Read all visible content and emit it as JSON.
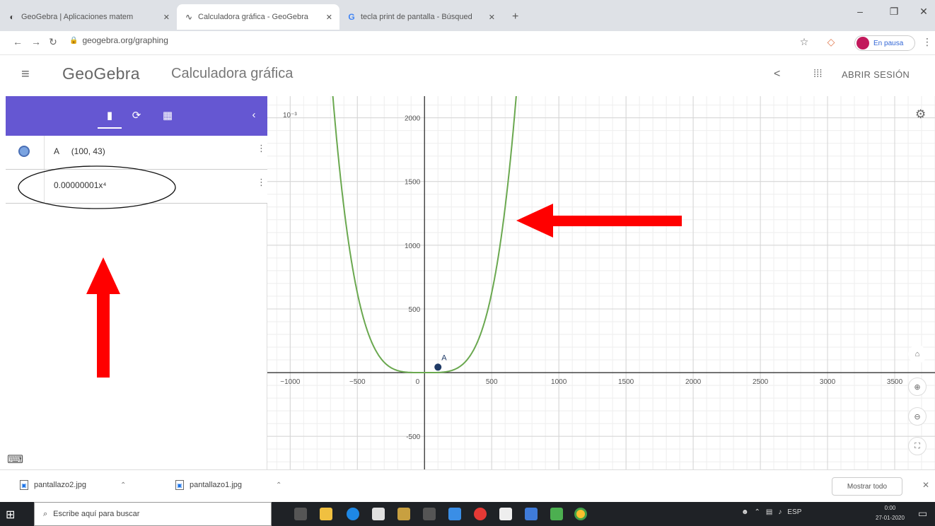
{
  "browser": {
    "tabs": [
      {
        "title": "GeoGebra | Aplicaciones matem",
        "icon": "geogebra-icon",
        "active": false
      },
      {
        "title": "Calculadora gráfica - GeoGebra",
        "icon": "geogebra-graphing-icon",
        "active": true
      },
      {
        "title": "tecla print de pantalla - Búsqued",
        "icon": "google-icon",
        "active": false
      }
    ],
    "new_tab_label": "+",
    "url": "geogebra.org/graphing",
    "profile_label": "En pausa"
  },
  "app": {
    "menu_icon": "≡",
    "brand": "GeoGebra",
    "title": "Calculadora gráfica",
    "sign_in": "ABRIR SESIÓN"
  },
  "algebra": {
    "rows": [
      {
        "label": "A",
        "value": "(100, 43)"
      },
      {
        "label": "",
        "value": "0.00000001x⁴"
      }
    ]
  },
  "graph": {
    "y_axis_label": "10⁻³",
    "x_ticks": [
      -1000,
      -500,
      0,
      500,
      1000,
      1500,
      2000,
      2500,
      3000,
      3500
    ],
    "x_tick_labels": [
      "−1000",
      "−500",
      "0",
      "500",
      "1000",
      "1500",
      "2000",
      "2500",
      "3000",
      "3500"
    ],
    "y_ticks": [
      -500,
      500,
      1000,
      1500,
      2000
    ],
    "y_tick_labels": [
      "-500",
      "500",
      "1000",
      "1500",
      "2000"
    ],
    "xlim": [
      -1170,
      3800
    ],
    "ylim": [
      -760,
      2170
    ],
    "point": {
      "name": "A",
      "x": 100,
      "y": 43
    },
    "curve_coefficient": 1e-08,
    "curve_exponent": 4,
    "curve_color": "#6aa84f",
    "point_color": "#1f3a66"
  },
  "downloads": {
    "items": [
      {
        "name": "pantallazo2.jpg"
      },
      {
        "name": "pantallazo1.jpg"
      }
    ],
    "show_all": "Mostrar todo"
  },
  "taskbar": {
    "search_placeholder": "Escribe aquí para buscar",
    "language": "ESP",
    "time": "0:00",
    "date": "27-01-2020"
  }
}
